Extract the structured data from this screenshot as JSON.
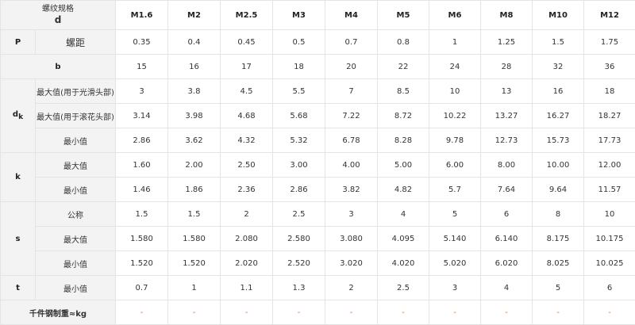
{
  "header": {
    "title_line1": "螺纹规格",
    "title_line2": "d",
    "sizes": [
      "M1.6",
      "M2",
      "M2.5",
      "M3",
      "M4",
      "M5",
      "M6",
      "M8",
      "M10",
      "M12"
    ]
  },
  "P": {
    "label": "P",
    "sublabel": "螺距",
    "values": [
      "0.35",
      "0.4",
      "0.45",
      "0.5",
      "0.7",
      "0.8",
      "1",
      "1.25",
      "1.5",
      "1.75"
    ]
  },
  "b": {
    "label": "b",
    "values": [
      "15",
      "16",
      "17",
      "18",
      "20",
      "22",
      "24",
      "28",
      "32",
      "36"
    ]
  },
  "dk": {
    "label_main": "d",
    "label_sub": "k",
    "rows": [
      {
        "label": "最大值(用于光滑头部)",
        "values": [
          "3",
          "3.8",
          "4.5",
          "5.5",
          "7",
          "8.5",
          "10",
          "13",
          "16",
          "18"
        ]
      },
      {
        "label": "最大值(用于滚花头部)",
        "values": [
          "3.14",
          "3.98",
          "4.68",
          "5.68",
          "7.22",
          "8.72",
          "10.22",
          "13.27",
          "16.27",
          "18.27"
        ]
      },
      {
        "label": "最小值",
        "values": [
          "2.86",
          "3.62",
          "4.32",
          "5.32",
          "6.78",
          "8.28",
          "9.78",
          "12.73",
          "15.73",
          "17.73"
        ]
      }
    ]
  },
  "k": {
    "label": "k",
    "rows": [
      {
        "label": "最大值",
        "values": [
          "1.60",
          "2.00",
          "2.50",
          "3.00",
          "4.00",
          "5.00",
          "6.00",
          "8.00",
          "10.00",
          "12.00"
        ]
      },
      {
        "label": "最小值",
        "values": [
          "1.46",
          "1.86",
          "2.36",
          "2.86",
          "3.82",
          "4.82",
          "5.7",
          "7.64",
          "9.64",
          "11.57"
        ]
      }
    ]
  },
  "s": {
    "label": "s",
    "rows": [
      {
        "label": "公称",
        "values": [
          "1.5",
          "1.5",
          "2",
          "2.5",
          "3",
          "4",
          "5",
          "6",
          "8",
          "10"
        ]
      },
      {
        "label": "最大值",
        "values": [
          "1.580",
          "1.580",
          "2.080",
          "2.580",
          "3.080",
          "4.095",
          "5.140",
          "6.140",
          "8.175",
          "10.175"
        ]
      },
      {
        "label": "最小值",
        "values": [
          "1.520",
          "1.520",
          "2.020",
          "2.520",
          "3.020",
          "4.020",
          "5.020",
          "6.020",
          "8.025",
          "10.025"
        ]
      }
    ]
  },
  "t": {
    "label": "t",
    "sublabel": "最小值",
    "values": [
      "0.7",
      "1",
      "1.1",
      "1.3",
      "2",
      "2.5",
      "3",
      "4",
      "5",
      "6"
    ]
  },
  "weight": {
    "label": "千件钢制重≈kg",
    "values": [
      "-",
      "-",
      "-",
      "-",
      "-",
      "-",
      "-",
      "-",
      "-",
      "-"
    ]
  },
  "colors": {
    "header_bg": "#f3f3f3",
    "border": "#e4e4e4",
    "dash": "#e6702a"
  }
}
